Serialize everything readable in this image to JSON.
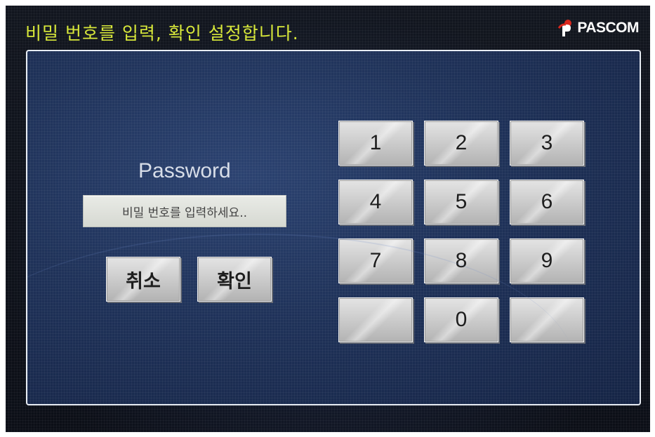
{
  "header": {
    "title": "비밀 번호를 입력, 확인 설정합니다.",
    "brand": "PASCOM",
    "title_color": "#d8e83a"
  },
  "form": {
    "label": "Password",
    "input_placeholder": "비밀 번호를 입력하세요..",
    "cancel_label": "취소",
    "confirm_label": "확인"
  },
  "keypad": {
    "keys": [
      "1",
      "2",
      "3",
      "4",
      "5",
      "6",
      "7",
      "8",
      "9",
      "",
      "0",
      ""
    ]
  },
  "colors": {
    "panel": "#1f3259",
    "button": "#c9c9c9",
    "logo_accent": "#d9261c"
  }
}
